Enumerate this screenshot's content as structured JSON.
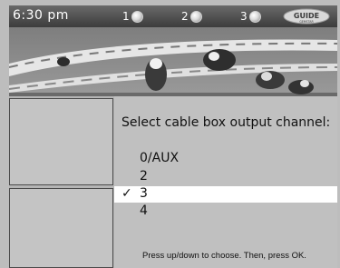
{
  "status_bar": {
    "time": "6:30 pm",
    "channels": [
      "1",
      "2",
      "3"
    ],
    "logo_text": "GUIDE GEMSTAR"
  },
  "dialog": {
    "prompt": "Select cable box output channel:",
    "options": [
      {
        "label": "0/AUX",
        "selected": false
      },
      {
        "label": "2",
        "selected": false
      },
      {
        "label": "3",
        "selected": true
      },
      {
        "label": "4",
        "selected": false
      }
    ],
    "check_mark": "✓",
    "hint": "Press up/down to choose. Then, press OK."
  }
}
